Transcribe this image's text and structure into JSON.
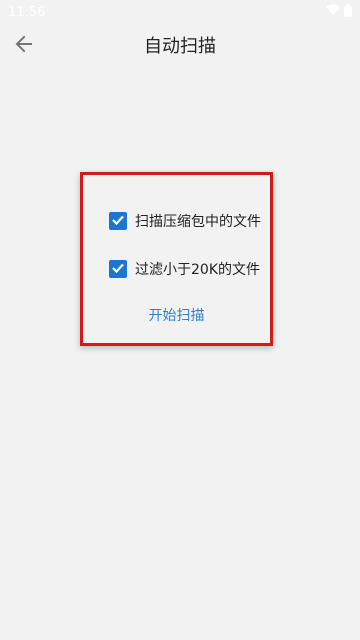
{
  "status_bar": {
    "time": "11:56"
  },
  "app_bar": {
    "title": "自动扫描"
  },
  "options": [
    {
      "label": "扫描压缩包中的文件",
      "checked": true
    },
    {
      "label": "过滤小于20K的文件",
      "checked": true
    }
  ],
  "actions": {
    "start_scan": "开始扫描"
  },
  "colors": {
    "accent": "#1976d2",
    "link": "#2f7fd6",
    "highlight_border": "#d11a1a",
    "background": "#f2f2f2"
  },
  "icons": {
    "back": "arrow-back-icon",
    "wifi": "wifi-icon",
    "battery": "battery-icon",
    "check": "check-icon"
  }
}
